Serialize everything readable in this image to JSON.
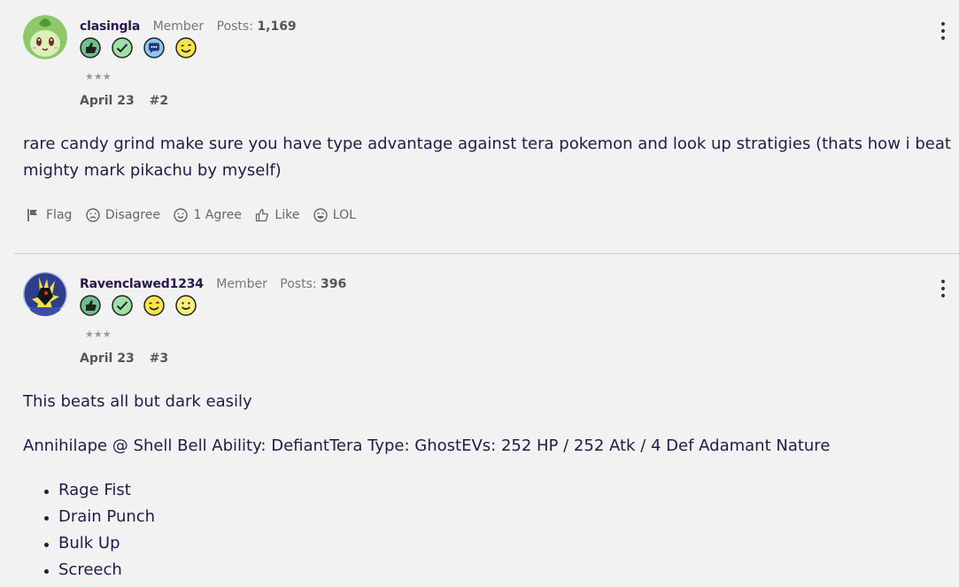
{
  "posts": [
    {
      "username": "clasingla",
      "role": "Member",
      "posts_label": "Posts:",
      "posts_count": "1,169",
      "badges": [
        "thumbs-up-badge",
        "checkmark-badge",
        "speech-bubble-badge",
        "winking-face-badge"
      ],
      "rank_stars": "★★★",
      "date": "April 23",
      "post_number": "#2",
      "body": "rare candy grind make sure you have type advantage against tera pokemon and look up stratigies (thats how i beat mighty mark pikachu by myself)",
      "actions": {
        "flag": "Flag",
        "disagree": "Disagree",
        "agree": "1 Agree",
        "like": "Like",
        "lol": "LOL"
      }
    },
    {
      "username": "Ravenclawed1234",
      "role": "Member",
      "posts_label": "Posts:",
      "posts_count": "396",
      "badges": [
        "thumbs-up-badge",
        "checkmark-badge",
        "winking-face-badge",
        "smiling-face-badge"
      ],
      "rank_stars": "★★★",
      "date": "April 23",
      "post_number": "#3",
      "body_paragraphs": [
        "This beats all but dark easily",
        "Annihilape @ Shell Bell Ability: DefiantTera Type: GhostEVs: 252 HP / 252 Atk / 4 Def Adamant Nature"
      ],
      "moves": [
        "Rage Fist",
        "Drain Punch",
        "Bulk Up",
        "Screech"
      ]
    }
  ],
  "colors": {
    "background": "#f2f2f2",
    "text": "#1f1d45",
    "username": "#2a184d",
    "muted": "#777777",
    "divider": "#cfcfcf"
  },
  "more_options_glyph": "• • •"
}
